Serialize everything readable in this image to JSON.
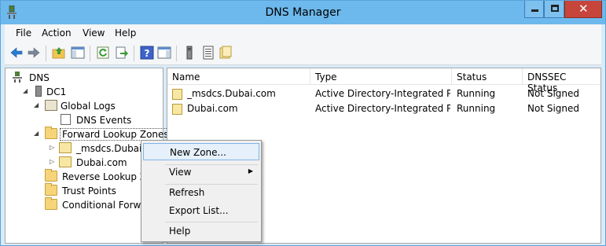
{
  "window": {
    "title": "DNS Manager"
  },
  "menu": {
    "file": "File",
    "action": "Action",
    "view": "View",
    "help": "Help"
  },
  "toolbar": {
    "icons": [
      "back-arrow-icon",
      "forward-arrow-icon",
      "up-folder-icon",
      "show-hide-tree-icon",
      "refresh-icon",
      "export-list-icon",
      "help-icon",
      "show-action-pane-icon",
      "server-icon",
      "list-icon",
      "zone-icon"
    ]
  },
  "tree": {
    "root": "DNS",
    "server": "DC1",
    "global_logs": "Global Logs",
    "dns_events": "DNS Events",
    "forward_zones": "Forward Lookup Zones",
    "msdcs_zone": "_msdcs.Dubai.c",
    "dubai_zone": "Dubai.com",
    "reverse_zones": "Reverse Lookup Zone",
    "trust_points": "Trust Points",
    "conditional": "Conditional Forwar"
  },
  "list": {
    "columns": [
      "Name",
      "Type",
      "Status",
      "DNSSEC Status"
    ],
    "rows": [
      [
        "_msdcs.Dubai.com",
        "Active Directory-Integrated Pr...",
        "Running",
        "Not Signed"
      ],
      [
        "Dubai.com",
        "Active Directory-Integrated Pr...",
        "Running",
        "Not Signed"
      ]
    ]
  },
  "context_menu": {
    "new_zone": "New Zone...",
    "view": "View",
    "refresh": "Refresh",
    "export_list": "Export List...",
    "help": "Help"
  },
  "colors": {
    "titlebar": "#6db8ec",
    "close_button": "#c7463b",
    "frame": "#d9ebf9",
    "highlight": "#e5f0fb"
  }
}
